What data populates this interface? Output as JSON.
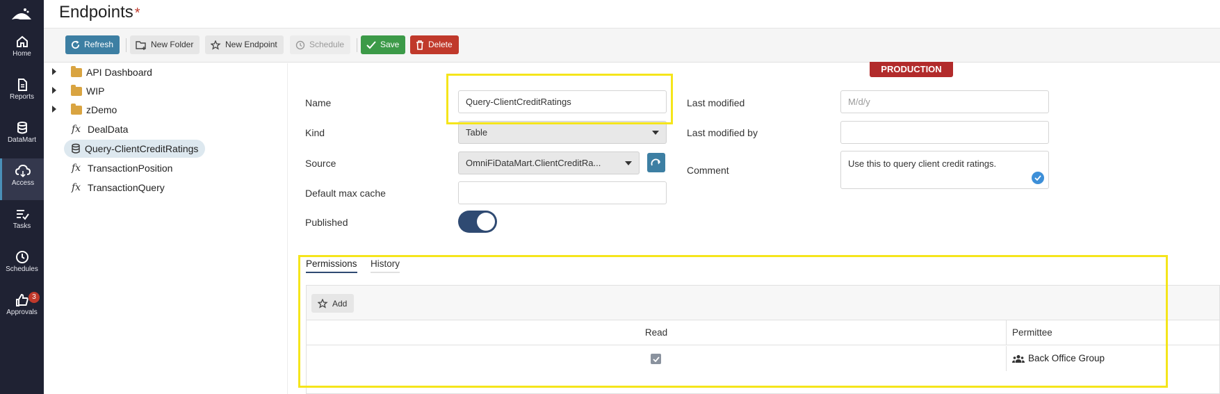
{
  "page": {
    "title": "Endpoints",
    "unsaved_marker": "*"
  },
  "nav": {
    "items": [
      {
        "label": "Home",
        "icon": "home-icon"
      },
      {
        "label": "Reports",
        "icon": "report-icon"
      },
      {
        "label": "DataMart",
        "icon": "database-icon"
      },
      {
        "label": "Access",
        "icon": "cloud-icon",
        "active": true
      },
      {
        "label": "Tasks",
        "icon": "tasks-icon"
      },
      {
        "label": "Schedules",
        "icon": "clock-icon"
      },
      {
        "label": "Approvals",
        "icon": "thumbs-up-icon",
        "badge": "3"
      }
    ]
  },
  "toolbar": {
    "refresh": "Refresh",
    "new_folder": "New Folder",
    "new_endpoint": "New Endpoint",
    "schedule": "Schedule",
    "save": "Save",
    "delete": "Delete"
  },
  "tree": {
    "folders": [
      "API Dashboard",
      "WIP",
      "zDemo"
    ],
    "items": [
      {
        "label": "DealData",
        "icon": "function-icon"
      },
      {
        "label": "Query-ClientCreditRatings",
        "icon": "database-icon",
        "selected": true
      },
      {
        "label": "TransactionPosition",
        "icon": "function-icon"
      },
      {
        "label": "TransactionQuery",
        "icon": "function-icon"
      }
    ]
  },
  "environment_badge": "PRODUCTION",
  "form": {
    "name_label": "Name",
    "name_value": "Query-ClientCreditRatings",
    "kind_label": "Kind",
    "kind_value": "Table",
    "source_label": "Source",
    "source_value": "OmniFiDataMart.ClientCreditRa...",
    "default_max_cache_label": "Default max cache",
    "default_max_cache_value": "",
    "published_label": "Published",
    "published": true,
    "last_modified_label": "Last modified",
    "last_modified_placeholder": "M/d/y",
    "last_modified_by_label": "Last modified by",
    "last_modified_by_value": "",
    "comment_label": "Comment",
    "comment_value": "Use this to query client credit ratings."
  },
  "tabs": {
    "permissions": "Permissions",
    "history": "History"
  },
  "permissions": {
    "add_label": "Add",
    "columns": {
      "read": "Read",
      "permittee": "Permittee"
    },
    "rows": [
      {
        "read": true,
        "permittee": "Back Office Group"
      }
    ]
  },
  "colors": {
    "rail": "#1f2233",
    "primary": "#3d7fa3",
    "save": "#3c9a48",
    "delete": "#c0392b",
    "production": "#b22b2b",
    "toggle_on": "#2f4a72",
    "highlight": "#f5e51b"
  }
}
